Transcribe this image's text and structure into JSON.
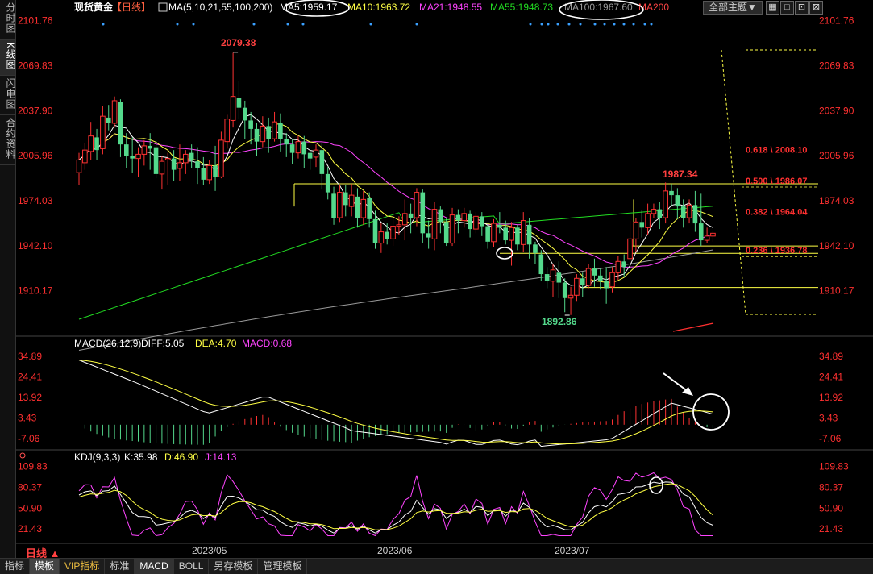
{
  "sidebar": [
    {
      "label": "分时图",
      "active": false
    },
    {
      "label": "K线图",
      "active": true
    },
    {
      "label": "闪电图",
      "active": false
    },
    {
      "label": "合约资料",
      "active": false
    }
  ],
  "header": {
    "symbol": "现货黄金",
    "period": "【日线】",
    "ma_prefix": "MA(5,10,21,55,100,200)",
    "ma5": "MA5:1959.17",
    "ma10": "MA10:1963.72",
    "ma21": "MA21:1948.55",
    "ma55": "MA55:1948.73",
    "ma100": "MA100:1967.60",
    "ma200": "MA200",
    "theme_button": "全部主题▼",
    "window_buttons": [
      "▦",
      "□",
      "⊡",
      "⊠"
    ]
  },
  "price_axis": [
    "2101.76",
    "2069.83",
    "2037.90",
    "2005.96",
    "1974.03",
    "1942.10",
    "1910.17"
  ],
  "macd_axis": [
    "34.89",
    "24.41",
    "13.92",
    "3.43",
    "-7.06"
  ],
  "kdj_axis": [
    "109.83",
    "80.37",
    "50.90",
    "21.43"
  ],
  "date_labels": [
    "2023/05",
    "2023/06",
    "2023/07"
  ],
  "annotations": {
    "high": "2079.38",
    "low": "1892.86",
    "recent_high": "1987.34"
  },
  "fib_levels": [
    {
      "label": "0.618 \\ 2008.10",
      "price": 2008.1
    },
    {
      "label": "0.500 \\ 1986.07",
      "price": 1986.07
    },
    {
      "label": "0.382 \\ 1964.04",
      "price": 1964.04
    },
    {
      "label": "0.236 \\ 1936.78",
      "price": 1936.78
    }
  ],
  "macd_header": {
    "name": "MACD(26,12,9)",
    "diff": "DIFF:5.05",
    "dea": "DEA:4.70",
    "macd": "MACD:0.68"
  },
  "kdj_header": {
    "name": "KDJ(9,3,3)",
    "k": "K:35.98",
    "d": "D:46.90",
    "j": "J:14.13"
  },
  "bottom_bar": {
    "period_label": "日线 ▲",
    "items": [
      "指标",
      "模板",
      "VIP指标",
      "标准",
      "MACD",
      "BOLL",
      "另存模板",
      "管理模板"
    ]
  },
  "colors": {
    "up": "#ff3232",
    "down": "#54d98c",
    "ma5": "#ffffff",
    "ma10": "#ffff44",
    "ma21": "#ff44ff",
    "ma55": "#22dd22",
    "ma100": "#9a9a9a",
    "ma200": "#ff4444",
    "axis_text": "#ff3030"
  },
  "chart_data": {
    "type": "candlestick",
    "title": "现货黄金 日线",
    "ylim": [
      1880,
      2105
    ],
    "candles": [
      [
        1994,
        2003,
        1985,
        2008
      ],
      [
        2001,
        2010,
        1996,
        2015
      ],
      [
        2009,
        2020,
        2003,
        2030
      ],
      [
        2019,
        2010,
        2003,
        2025
      ],
      [
        2011,
        2034,
        2007,
        2041
      ],
      [
        2033,
        2029,
        2024,
        2042
      ],
      [
        2029,
        2045,
        2026,
        2048
      ],
      [
        2044,
        2014,
        2005,
        2046
      ],
      [
        2014,
        2006,
        1997,
        2022
      ],
      [
        2006,
        2004,
        1994,
        2019
      ],
      [
        2004,
        2007,
        1991,
        2012
      ],
      [
        2007,
        2013,
        1999,
        2017
      ],
      [
        2013,
        2011,
        1996,
        2022
      ],
      [
        2012,
        1993,
        1990,
        2017
      ],
      [
        1993,
        2002,
        1982,
        2006
      ],
      [
        2003,
        2004,
        1985,
        2008
      ],
      [
        2004,
        1996,
        1988,
        2010
      ],
      [
        1997,
        2001,
        1988,
        2014
      ],
      [
        2001,
        2007,
        1993,
        2010
      ],
      [
        2008,
        2003,
        1997,
        2014
      ],
      [
        2002,
        1997,
        1986,
        2012
      ],
      [
        1997,
        1989,
        1985,
        2005
      ],
      [
        1989,
        1999,
        1986,
        2003
      ],
      [
        1999,
        1991,
        1981,
        2013
      ],
      [
        1991,
        2017,
        1990,
        2023
      ],
      [
        2016,
        2032,
        2011,
        2035
      ],
      [
        2031,
        2048,
        2026,
        2079
      ],
      [
        2047,
        2040,
        2032,
        2059
      ],
      [
        2040,
        2031,
        2018,
        2045
      ],
      [
        2031,
        2025,
        2014,
        2037
      ],
      [
        2025,
        2016,
        2006,
        2029
      ],
      [
        2016,
        2027,
        2012,
        2034
      ],
      [
        2027,
        2018,
        2008,
        2033
      ],
      [
        2018,
        2030,
        2016,
        2037
      ],
      [
        2029,
        2018,
        2009,
        2036
      ],
      [
        2018,
        2014,
        2005,
        2022
      ],
      [
        2014,
        2008,
        2000,
        2018
      ],
      [
        2008,
        2016,
        2004,
        2020
      ],
      [
        2016,
        2007,
        1997,
        2020
      ],
      [
        2008,
        2004,
        1996,
        2010
      ],
      [
        2005,
        2010,
        1998,
        2014
      ],
      [
        2010,
        1993,
        1982,
        2015
      ],
      [
        1993,
        1980,
        1975,
        1998
      ],
      [
        1979,
        1962,
        1957,
        1984
      ],
      [
        1962,
        1980,
        1959,
        1985
      ],
      [
        1980,
        1971,
        1963,
        1985
      ],
      [
        1970,
        1978,
        1963,
        1986
      ],
      [
        1977,
        1962,
        1955,
        1983
      ],
      [
        1962,
        1975,
        1957,
        1981
      ],
      [
        1976,
        1961,
        1955,
        1980
      ],
      [
        1961,
        1944,
        1940,
        1967
      ],
      [
        1944,
        1952,
        1937,
        1958
      ],
      [
        1952,
        1947,
        1943,
        1958
      ],
      [
        1947,
        1956,
        1942,
        1967
      ],
      [
        1956,
        1957,
        1950,
        1963
      ],
      [
        1957,
        1965,
        1946,
        1975
      ],
      [
        1965,
        1962,
        1951,
        1972
      ],
      [
        1962,
        1980,
        1956,
        1983
      ],
      [
        1980,
        1951,
        1944,
        1982
      ],
      [
        1951,
        1948,
        1940,
        1960
      ],
      [
        1947,
        1968,
        1939,
        1973
      ],
      [
        1968,
        1959,
        1951,
        1970
      ],
      [
        1959,
        1944,
        1942,
        1962
      ],
      [
        1944,
        1964,
        1942,
        1969
      ],
      [
        1964,
        1960,
        1951,
        1968
      ],
      [
        1960,
        1965,
        1955,
        1969
      ],
      [
        1965,
        1954,
        1948,
        1967
      ],
      [
        1954,
        1963,
        1951,
        1966
      ],
      [
        1963,
        1956,
        1949,
        1966
      ],
      [
        1956,
        1945,
        1940,
        1958
      ],
      [
        1945,
        1958,
        1941,
        1961
      ],
      [
        1957,
        1955,
        1951,
        1966
      ],
      [
        1955,
        1946,
        1943,
        1960
      ],
      [
        1946,
        1955,
        1928,
        1959
      ],
      [
        1955,
        1943,
        1939,
        1957
      ],
      [
        1943,
        1960,
        1938,
        1966
      ],
      [
        1957,
        1943,
        1933,
        1962
      ],
      [
        1943,
        1937,
        1929,
        1945
      ],
      [
        1936,
        1922,
        1917,
        1939
      ],
      [
        1922,
        1917,
        1912,
        1927
      ],
      [
        1917,
        1925,
        1906,
        1929
      ],
      [
        1923,
        1916,
        1905,
        1931
      ],
      [
        1916,
        1905,
        1895,
        1919
      ],
      [
        1905,
        1907,
        1893,
        1913
      ],
      [
        1907,
        1919,
        1903,
        1922
      ],
      [
        1919,
        1914,
        1906,
        1923
      ],
      [
        1914,
        1926,
        1912,
        1929
      ],
      [
        1926,
        1921,
        1913,
        1933
      ],
      [
        1921,
        1917,
        1911,
        1926
      ],
      [
        1917,
        1912,
        1901,
        1927
      ],
      [
        1913,
        1923,
        1909,
        1927
      ],
      [
        1923,
        1931,
        1918,
        1935
      ],
      [
        1931,
        1927,
        1920,
        1936
      ],
      [
        1933,
        1947,
        1930,
        1960
      ],
      [
        1947,
        1959,
        1938,
        1962
      ],
      [
        1959,
        1955,
        1948,
        1967
      ],
      [
        1955,
        1965,
        1950,
        1972
      ],
      [
        1965,
        1968,
        1962,
        1972
      ],
      [
        1968,
        1962,
        1954,
        1973
      ],
      [
        1962,
        1981,
        1958,
        1987
      ],
      [
        1981,
        1978,
        1970,
        1986
      ],
      [
        1978,
        1970,
        1961,
        1983
      ],
      [
        1970,
        1962,
        1955,
        1975
      ],
      [
        1962,
        1971,
        1958,
        1975
      ],
      [
        1971,
        1958,
        1952,
        1981
      ],
      [
        1958,
        1946,
        1942,
        1979
      ],
      [
        1946,
        1949,
        1944,
        1955
      ],
      [
        1949,
        1951,
        1945,
        1953
      ]
    ],
    "macd": {
      "diff_start": 33,
      "diff_end": 5.05,
      "dea_end": 4.7,
      "hist_end": 0.68
    },
    "kdj": {
      "k_end": 35.98,
      "d_end": 46.9,
      "j_end": 14.13
    }
  }
}
